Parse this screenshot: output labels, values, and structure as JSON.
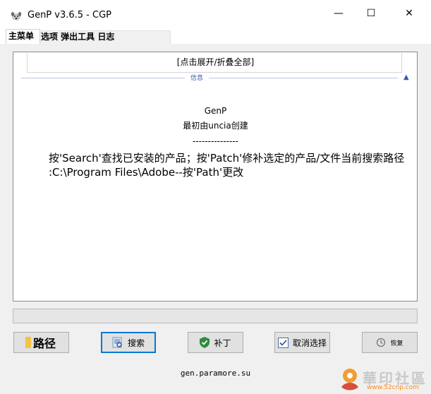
{
  "window": {
    "title": "GenP v3.6.5 - CGP",
    "min_glyph": "—",
    "max_glyph": "☐",
    "close_glyph": "✕",
    "app_icon": "dog-icon"
  },
  "menu": {
    "main_tab": "主菜单",
    "other_tabs": "选项 弹出工具 日志"
  },
  "panel": {
    "collapse_label": "[点击展开/折叠全部]",
    "info_label": "信息",
    "caret": "▲",
    "app_name": "GenP",
    "created_by": "最初由uncia创建",
    "separator": "---------------",
    "line1": "按'Search'查找已安装的产品；按'Patch'修补选定的产品/文件当前搜索路径",
    "line2": ":C:\\Program Files\\Adobe--按'Path'更改"
  },
  "progress": {
    "value_percent": 0
  },
  "buttons": {
    "path": {
      "label": "路径",
      "icon": "folder-icon"
    },
    "search": {
      "label": "搜索",
      "icon": "search-icon"
    },
    "patch": {
      "label": "补丁",
      "icon": "shield-check-icon"
    },
    "deselect": {
      "label": "取消选择",
      "icon": "checkbox-icon"
    },
    "restore": {
      "label": "恢复",
      "icon": "restore-icon"
    }
  },
  "footer": {
    "text": "gen.paramore.su"
  },
  "watermark": {
    "text": "華印社區",
    "url": "www.52cnp.com"
  },
  "colors": {
    "accent": "#0078d7",
    "info_blue": "#3a5aa8",
    "panel_bg": "#f0f0f0"
  }
}
